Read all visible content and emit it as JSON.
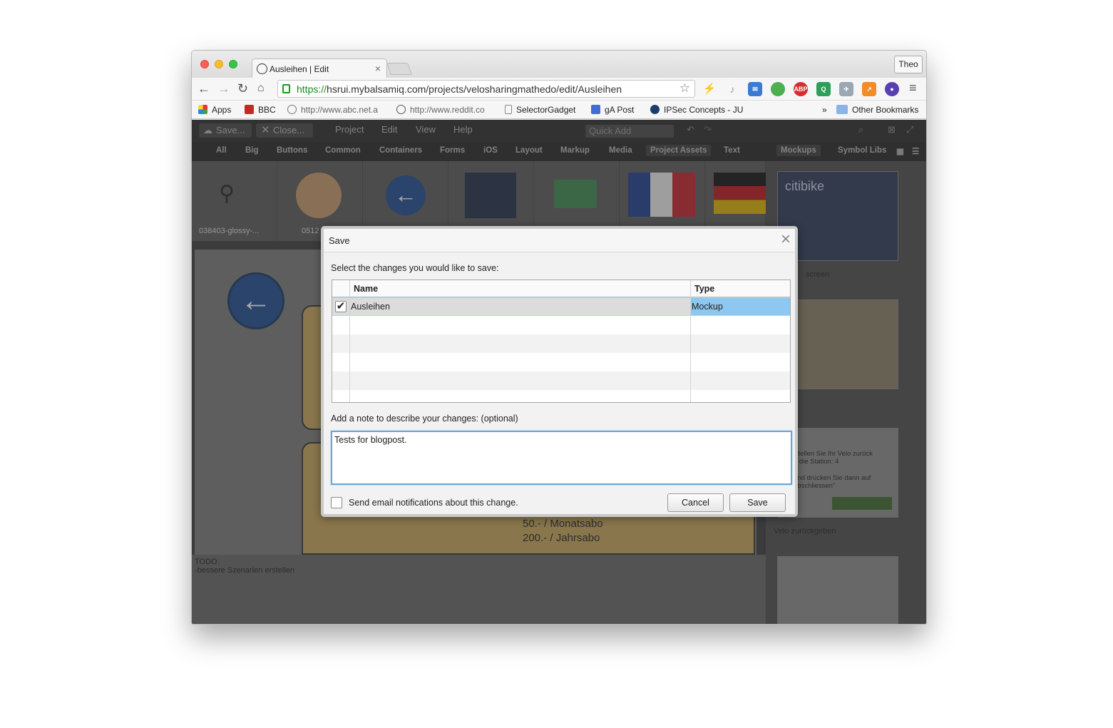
{
  "browser": {
    "tab_title": "Ausleihen | Edit",
    "profile_name": "Theo",
    "url_scheme": "https://",
    "url_rest": "hsrui.mybalsamiq.com/projects/velosharingmathedo/edit/Ausleihen",
    "bookmarks": {
      "apps": "Apps",
      "bbc": "BBC",
      "abc": "http://www.abc.net.a",
      "reddit": "http://www.reddit.co",
      "selectorgadget": "SelectorGadget",
      "ga_post": "gA Post",
      "ipsec": "IPSec Concepts - JU",
      "overflow": "»",
      "other": "Other Bookmarks"
    }
  },
  "app": {
    "toolbar": {
      "save": "Save...",
      "close": "Close...",
      "menus": [
        "Project",
        "Edit",
        "View",
        "Help"
      ],
      "quick_add_placeholder": "Quick Add"
    },
    "categories": [
      "All",
      "Big",
      "Buttons",
      "Common",
      "Containers",
      "Forms",
      "iOS",
      "Layout",
      "Markup",
      "Media",
      "Project Assets",
      "Text"
    ],
    "right_tabs": [
      "Mockups",
      "Symbol Libs"
    ],
    "assets": [
      {
        "label": "038403-glossy-..."
      },
      {
        "label": "0512"
      }
    ],
    "right_panel": {
      "thumb1_text": "citibike",
      "thumb1_label": "screen",
      "thumb3_text_lines": [
        "Stellen Sie Ihr Velo zurück",
        "n die Station: 4",
        "und drücken Sie dann auf",
        "abschliessen\""
      ],
      "thumb3_label": "Velo zurückgeben"
    },
    "canvas": {
      "line1": "50.- / Monatsabo",
      "line2": "200.- / Jahrsabo"
    },
    "notes": {
      "line1": "TODO:",
      "line2": "-bessere Szenarien erstellen"
    }
  },
  "dialog": {
    "title": "Save",
    "instruction": "Select the changes you would like to save:",
    "columns": {
      "name": "Name",
      "type": "Type"
    },
    "rows": [
      {
        "name": "Ausleihen",
        "type": "Mockup",
        "checked": true
      }
    ],
    "note_label": "Add a note to describe your changes: (optional)",
    "note_value": "Tests for blogpost.",
    "email_label": "Send email notifications about this change.",
    "cancel": "Cancel",
    "save": "Save"
  }
}
